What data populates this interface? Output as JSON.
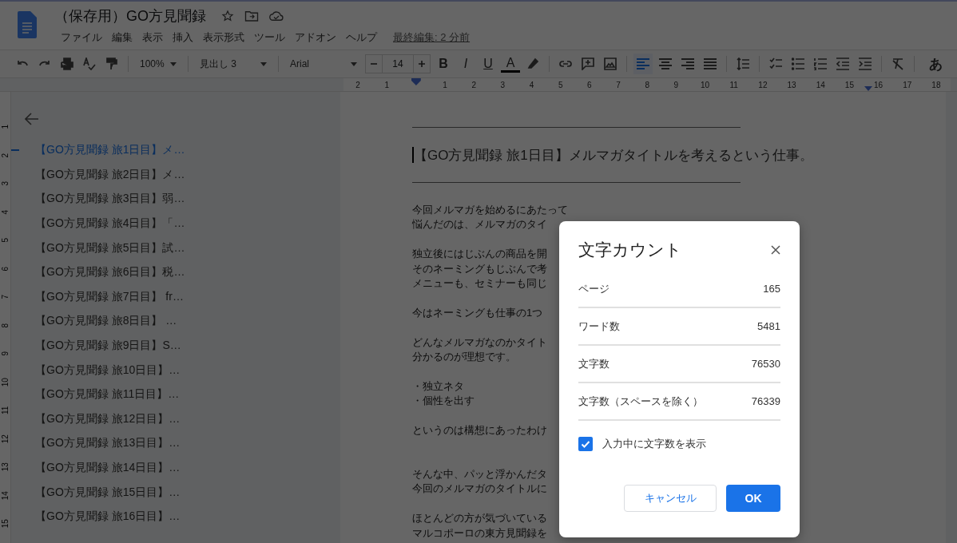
{
  "header": {
    "title": "（保存用）GO方見聞録",
    "menus": [
      "ファイル",
      "編集",
      "表示",
      "挿入",
      "表示形式",
      "ツール",
      "アドオン",
      "ヘルプ"
    ],
    "last_edit": "最終編集: 2 分前"
  },
  "toolbar": {
    "tools": [
      {
        "kind": "undo"
      },
      {
        "kind": "redo"
      },
      {
        "kind": "print"
      },
      {
        "kind": "spellcheck"
      },
      {
        "kind": "paint-format"
      },
      {
        "kind": "sep"
      },
      {
        "kind": "dropdown",
        "label": "100%"
      },
      {
        "kind": "sep"
      },
      {
        "kind": "dropdown",
        "label": "見出し 3"
      },
      {
        "kind": "sep"
      },
      {
        "kind": "dropdown",
        "label": "Arial"
      },
      {
        "kind": "size",
        "label": "14"
      },
      {
        "kind": "bold",
        "label": "B"
      },
      {
        "kind": "italic",
        "label": "I"
      },
      {
        "kind": "underline",
        "label": "U"
      },
      {
        "kind": "text-color",
        "label": "A"
      },
      {
        "kind": "highlight"
      },
      {
        "kind": "sep"
      },
      {
        "kind": "link"
      },
      {
        "kind": "comment"
      },
      {
        "kind": "image"
      },
      {
        "kind": "sep"
      },
      {
        "kind": "align-left",
        "selected": true
      },
      {
        "kind": "align-center",
        "selected": false
      },
      {
        "kind": "align-right",
        "selected": false
      },
      {
        "kind": "align-justify",
        "selected": false
      },
      {
        "kind": "sep"
      },
      {
        "kind": "line-spacing"
      },
      {
        "kind": "sep"
      },
      {
        "kind": "checklist"
      },
      {
        "kind": "bullets"
      },
      {
        "kind": "numbered"
      },
      {
        "kind": "outdent"
      },
      {
        "kind": "indent"
      },
      {
        "kind": "sep"
      },
      {
        "kind": "clear-format"
      },
      {
        "kind": "sep"
      },
      {
        "kind": "input-tool",
        "label": "あ"
      }
    ]
  },
  "ruler": {
    "left_labels": [
      "2",
      "1"
    ],
    "right_labels": [
      "1",
      "2",
      "3",
      "4",
      "5",
      "6",
      "7",
      "8",
      "9",
      "10",
      "11",
      "12",
      "13",
      "14",
      "15",
      "16",
      "17",
      "18"
    ]
  },
  "vertical_ruler": {
    "labels": [
      "1",
      "2",
      "3",
      "4",
      "5",
      "6",
      "7",
      "8",
      "9",
      "10",
      "11",
      "12",
      "13",
      "14",
      "15"
    ]
  },
  "outline": {
    "items": [
      {
        "label": "【GO方見聞録 旅1日目】メ…",
        "selected": true
      },
      {
        "label": "【GO方見聞録 旅2日目】メ…",
        "selected": false
      },
      {
        "label": "【GO方見聞録 旅3日目】弱…",
        "selected": false
      },
      {
        "label": "【GO方見聞録 旅4日目】「…",
        "selected": false
      },
      {
        "label": "【GO方見聞録 旅5日目】試…",
        "selected": false
      },
      {
        "label": "【GO方見聞録 旅6日目】税…",
        "selected": false
      },
      {
        "label": "【GO方見聞録 旅7日目】 fr…",
        "selected": false
      },
      {
        "label": "【GO方見聞録 旅8日目】 …",
        "selected": false
      },
      {
        "label": "【GO方見聞録 旅9日目】S…",
        "selected": false
      },
      {
        "label": "【GO方見聞録 旅10日目】…",
        "selected": false
      },
      {
        "label": "【GO方見聞録 旅11日目】…",
        "selected": false
      },
      {
        "label": "【GO方見聞録 旅12日目】…",
        "selected": false
      },
      {
        "label": "【GO方見聞録 旅13日目】…",
        "selected": false
      },
      {
        "label": "【GO方見聞録 旅14日目】…",
        "selected": false
      },
      {
        "label": "【GO方見聞録 旅15日目】…",
        "selected": false
      },
      {
        "label": "【GO方見聞録 旅16日目】…",
        "selected": false
      }
    ]
  },
  "document": {
    "heading": "【GO方見聞録 旅1日目】メルマガタイトルを考えるという仕事。",
    "paragraphs": [
      {
        "lines": [
          "今回メルマガを始めるにあたって",
          "悩んだのは、メルマガのタイ"
        ],
        "wide_gap": false
      },
      {
        "lines": [
          "独立後にはじぶんの商品を開",
          "そのネーミングもじぶんで考",
          "メニューも、セミナーも同じ"
        ],
        "wide_gap": false
      },
      {
        "lines": [
          "今はネーミングも仕事の1つ"
        ],
        "wide_gap": false
      },
      {
        "lines": [
          "どんなメルマガなのかタイト",
          "分かるのが理想です。"
        ],
        "wide_gap": false
      },
      {
        "lines": [
          "・独立ネタ",
          "・個性を出す"
        ],
        "wide_gap": false
      },
      {
        "lines": [
          "というのは構想にあったわけ"
        ],
        "wide_gap": true
      },
      {
        "lines": [
          "そんな中、パッと浮かんだタ",
          "今回のメルマガのタイトルに"
        ],
        "wide_gap": false
      },
      {
        "lines": [
          "ほとんどの方が気づいている",
          "マルコポーロの東方見聞録を"
        ],
        "wide_gap": false
      }
    ]
  },
  "dialog": {
    "title": "文字カウント",
    "stats": [
      {
        "label": "ページ",
        "value": "165"
      },
      {
        "label": "ワード数",
        "value": "5481"
      },
      {
        "label": "文字数",
        "value": "76530"
      },
      {
        "label": "文字数（スペースを除く）",
        "value": "76339"
      }
    ],
    "show_while_typing": {
      "label": "入力中に文字数を表示",
      "checked": true
    },
    "cancel": "キャンセル",
    "ok": "OK"
  }
}
